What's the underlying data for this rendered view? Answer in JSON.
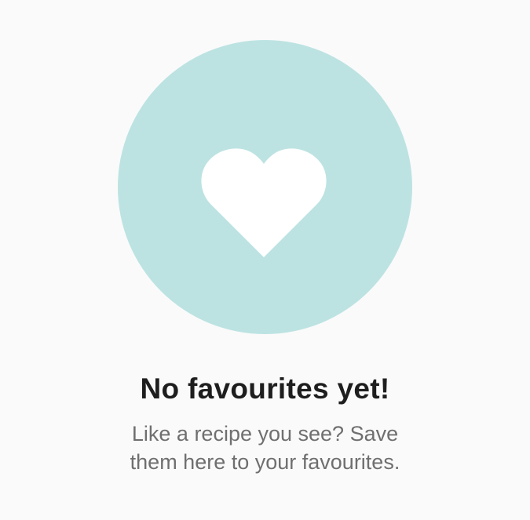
{
  "empty_state": {
    "icon": "heart-icon",
    "circle_color": "#bce3e2",
    "heart_color": "#ffffff",
    "title": "No favourites yet!",
    "description_line1": "Like a recipe you see? Save",
    "description_line2": "them here to your favourites."
  }
}
